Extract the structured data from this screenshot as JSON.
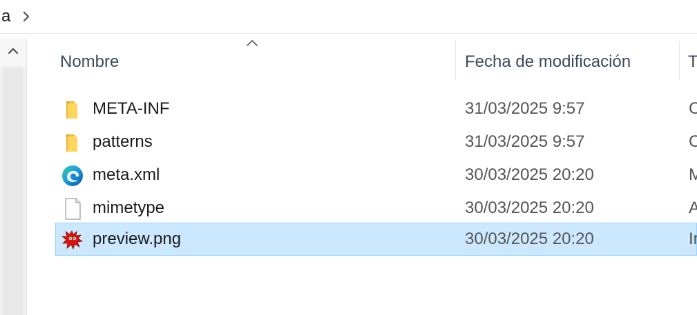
{
  "breadcrumb": {
    "text": "a"
  },
  "columns": {
    "name": "Nombre",
    "date": "Fecha de modificación",
    "type": "T"
  },
  "files": [
    {
      "name": "META-INF",
      "date": "31/03/2025 9:57",
      "type": "C",
      "icon": "folder-icon"
    },
    {
      "name": "patterns",
      "date": "31/03/2025 9:57",
      "type": "C",
      "icon": "folder-icon"
    },
    {
      "name": "meta.xml",
      "date": "30/03/2025 20:20",
      "type": "M",
      "icon": "edge-browser-icon"
    },
    {
      "name": "mimetype",
      "date": "30/03/2025 20:20",
      "type": "A",
      "icon": "blank-file-icon"
    },
    {
      "name": "preview.png",
      "date": "30/03/2025 20:20",
      "type": "Ir",
      "icon": "paint-splat-icon",
      "selected": true
    }
  ],
  "colors": {
    "selection_fill": "#cce8ff",
    "selection_border": "#99d1ff",
    "header_text": "#3c4a5a",
    "folder": "#f5c84c"
  }
}
